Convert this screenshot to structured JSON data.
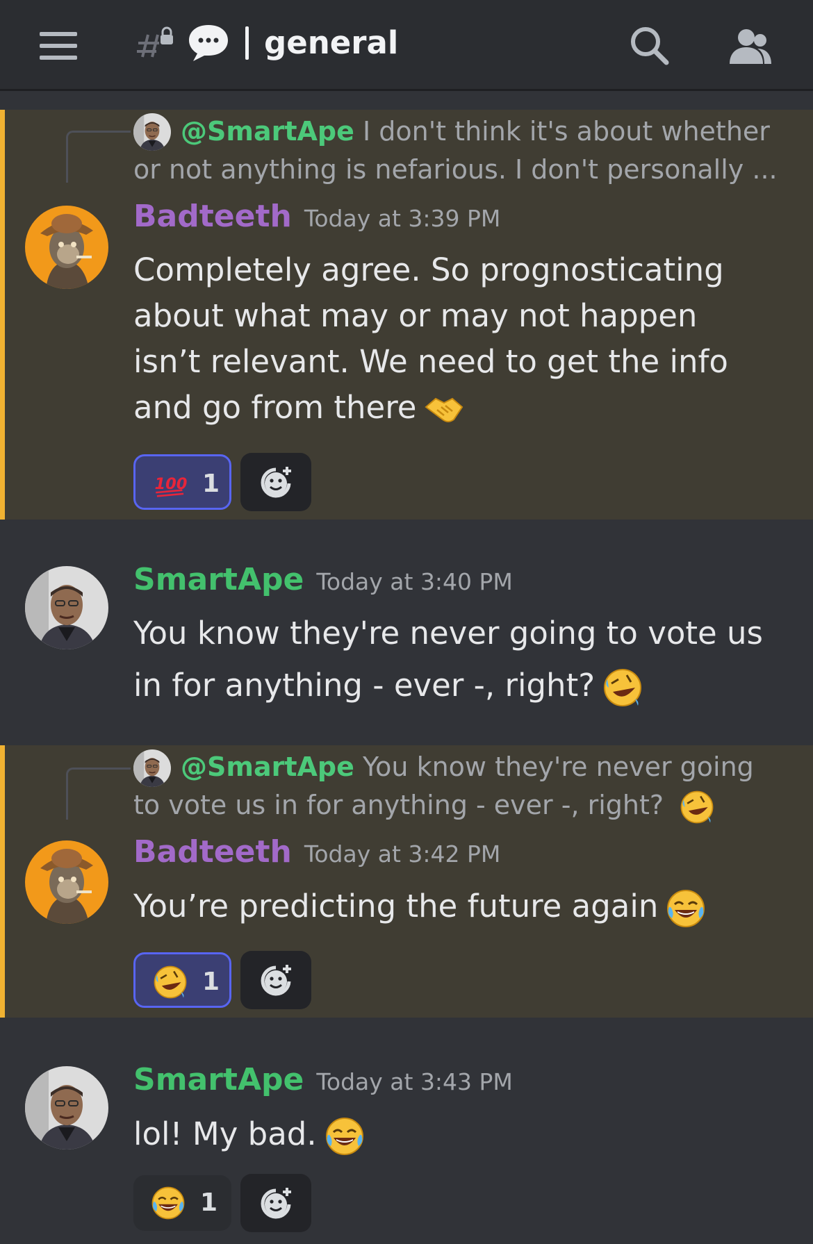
{
  "header": {
    "channel_name": "general",
    "icons": [
      "menu-icon",
      "locked-channel-icon",
      "speech-bubble-icon",
      "search-icon",
      "members-icon"
    ]
  },
  "messages": [
    {
      "reply": {
        "mention": "@SmartApe",
        "text": "I don't think it's about whether or not anything is nefarious. I don't personally ..."
      },
      "author": "Badteeth",
      "timestamp": "Today at 3:39 PM",
      "text": "Completely agree. So prognosticating about what may or may not happen isn’t relevant. We need to get the info and go from there",
      "inline_emoji": "handshake",
      "reactions": [
        {
          "emoji": "hundred-points",
          "count": "1",
          "active": true
        }
      ]
    },
    {
      "author": "SmartApe",
      "timestamp": "Today at 3:40 PM",
      "text": "You know they're never going to vote us in for anything - ever -, right?",
      "inline_emoji": "rolling-on-floor-laughing"
    },
    {
      "reply": {
        "mention": "@SmartApe",
        "text": "You know they're never going to vote us in for anything - ever -, right?"
      },
      "author": "Badteeth",
      "timestamp": "Today at 3:42 PM",
      "text": "You’re predicting the future again",
      "inline_emoji": "tears-of-joy",
      "reactions": [
        {
          "emoji": "rolling-on-floor-laughing",
          "count": "1",
          "active": true
        }
      ]
    },
    {
      "author": "SmartApe",
      "timestamp": "Today at 3:43 PM",
      "text": "lol! My bad.",
      "inline_emoji": "tears-of-joy",
      "reactions": [
        {
          "emoji": "tears-of-joy",
          "count": "1",
          "active": false
        }
      ]
    }
  ],
  "colors": {
    "background": "#313338",
    "header": "#2b2d31",
    "highlight": "#403d33",
    "highlight_bar": "#f0b232",
    "badteeth": "#a26ac9",
    "smartape": "#43c16d",
    "reaction_active_border": "#5865f2"
  }
}
